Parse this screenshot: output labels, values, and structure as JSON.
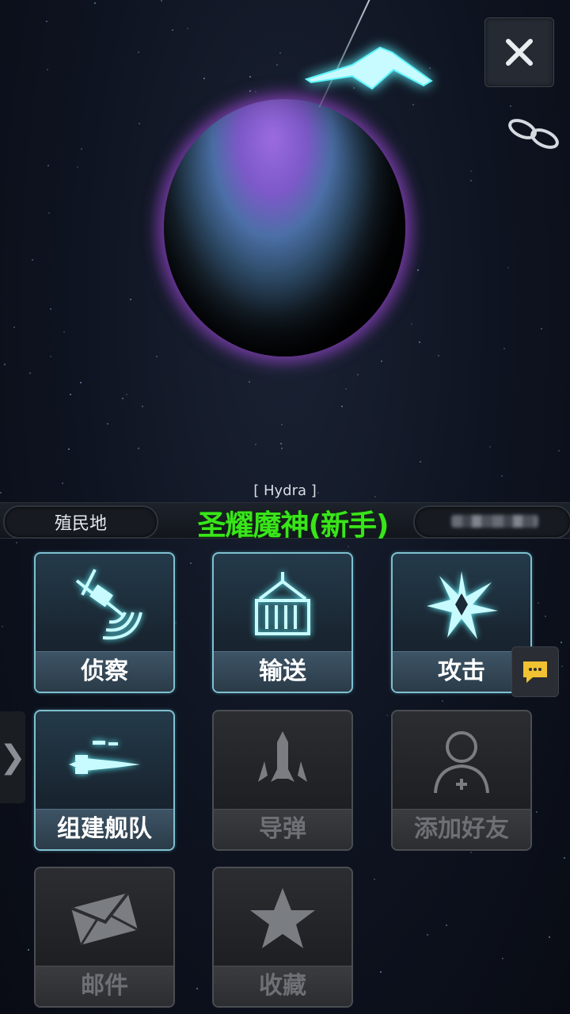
{
  "system_name": "[ Hydra ]",
  "player_name": "圣耀魔神(新手)",
  "colony_label": "殖民地",
  "close_icon": "close-icon",
  "buttons": [
    {
      "label": "侦察",
      "icon": "satellite-icon",
      "enabled": true
    },
    {
      "label": "输送",
      "icon": "cargo-container-icon",
      "enabled": true
    },
    {
      "label": "攻击",
      "icon": "explosion-icon",
      "enabled": true
    },
    {
      "label": "组建舰队",
      "icon": "fleet-ships-icon",
      "enabled": true
    },
    {
      "label": "导弹",
      "icon": "missile-icon",
      "enabled": false
    },
    {
      "label": "添加好友",
      "icon": "add-friend-icon",
      "enabled": false
    },
    {
      "label": "邮件",
      "icon": "mail-icon",
      "enabled": false
    },
    {
      "label": "收藏",
      "icon": "star-icon",
      "enabled": false
    }
  ],
  "colors": {
    "player_name": "#39e51a",
    "active_border": "#7fc0d1",
    "icon_glow": "#5ff5ff",
    "planet_glow": "#aa50e6"
  }
}
